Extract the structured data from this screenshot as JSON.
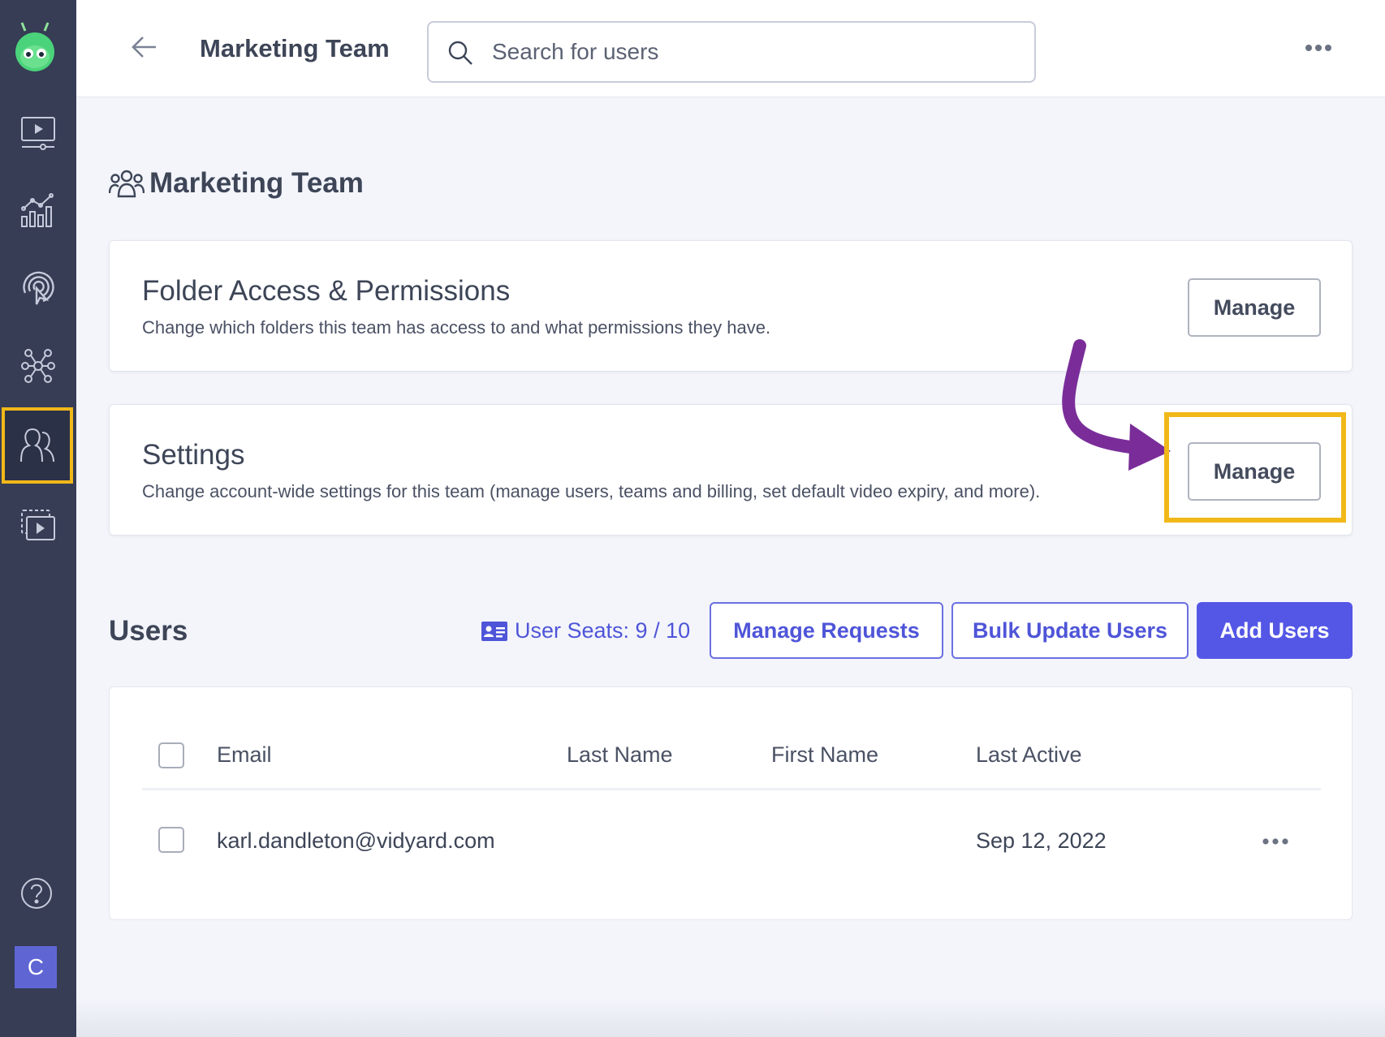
{
  "header": {
    "title": "Marketing Team",
    "search_placeholder": "Search for users"
  },
  "page": {
    "title": "Marketing Team"
  },
  "cards": {
    "folder": {
      "title": "Folder Access & Permissions",
      "description": "Change which folders this team has access to and what permissions they have.",
      "button": "Manage"
    },
    "settings": {
      "title": "Settings",
      "description": "Change account-wide settings for this team (manage users, teams and billing, set default video expiry, and more).",
      "button": "Manage"
    }
  },
  "users": {
    "heading": "Users",
    "seats_label": "User Seats: 9 / 10",
    "manage_requests": "Manage Requests",
    "bulk_update": "Bulk Update Users",
    "add_users": "Add Users",
    "columns": [
      "Email",
      "Last Name",
      "First Name",
      "Last Active"
    ],
    "rows": [
      {
        "email": "karl.dandleton@vidyard.com",
        "last_name": "",
        "first_name": "",
        "last_active": "Sep 12, 2022"
      }
    ]
  },
  "sidebar": {
    "avatar_initial": "C",
    "items": [
      "video-library-icon",
      "analytics-icon",
      "engagement-icon",
      "integrations-icon",
      "teams-icon",
      "video-hub-icon"
    ],
    "active_item": "teams-icon"
  },
  "colors": {
    "sidebar": "#363d55",
    "accent": "#5457e6",
    "highlight": "#f1b81a",
    "arrow": "#7a2d99"
  }
}
